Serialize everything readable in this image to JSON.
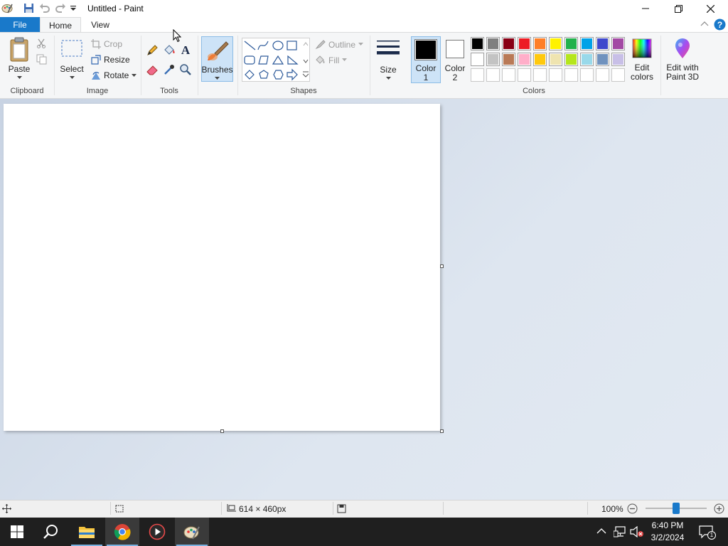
{
  "window": {
    "title": "Untitled - Paint"
  },
  "tabs": {
    "file": "File",
    "home": "Home",
    "view": "View"
  },
  "clipboard": {
    "paste": "Paste",
    "group": "Clipboard"
  },
  "image": {
    "select": "Select",
    "crop": "Crop",
    "resize": "Resize",
    "rotate": "Rotate",
    "group": "Image"
  },
  "tools": {
    "group": "Tools"
  },
  "brushes": {
    "label": "Brushes"
  },
  "shapes": {
    "outline": "Outline",
    "fill": "Fill",
    "group": "Shapes"
  },
  "size": {
    "label": "Size"
  },
  "colors": {
    "color1_line1": "Color",
    "color1_line2": "1",
    "color2_line1": "Color",
    "color2_line2": "2",
    "edit_line1": "Edit",
    "edit_line2": "colors",
    "paint3d_line1": "Edit with",
    "paint3d_line2": "Paint 3D",
    "group": "Colors",
    "color1_value": "#000000",
    "color2_value": "#ffffff",
    "row1": [
      "#000000",
      "#7f7f7f",
      "#880015",
      "#ed1c24",
      "#ff7f27",
      "#fff200",
      "#22b14c",
      "#00a2e8",
      "#3f48cc",
      "#a349a4"
    ],
    "row2": [
      "#ffffff",
      "#c3c3c3",
      "#b97a57",
      "#ffaec9",
      "#ffc90e",
      "#efe4b0",
      "#b5e61d",
      "#99d9ea",
      "#7092be",
      "#c8bfe7"
    ],
    "row3": [
      "#ffffff",
      "#ffffff",
      "#ffffff",
      "#ffffff",
      "#ffffff",
      "#ffffff",
      "#ffffff",
      "#ffffff",
      "#ffffff",
      "#ffffff"
    ]
  },
  "status": {
    "dimensions": "614 × 460px",
    "zoom": "100%",
    "zoom_level": 0.5
  },
  "taskbar": {
    "time": "6:40 PM",
    "date": "3/2/2024",
    "notifications": "1"
  },
  "accent": "#1979ca"
}
